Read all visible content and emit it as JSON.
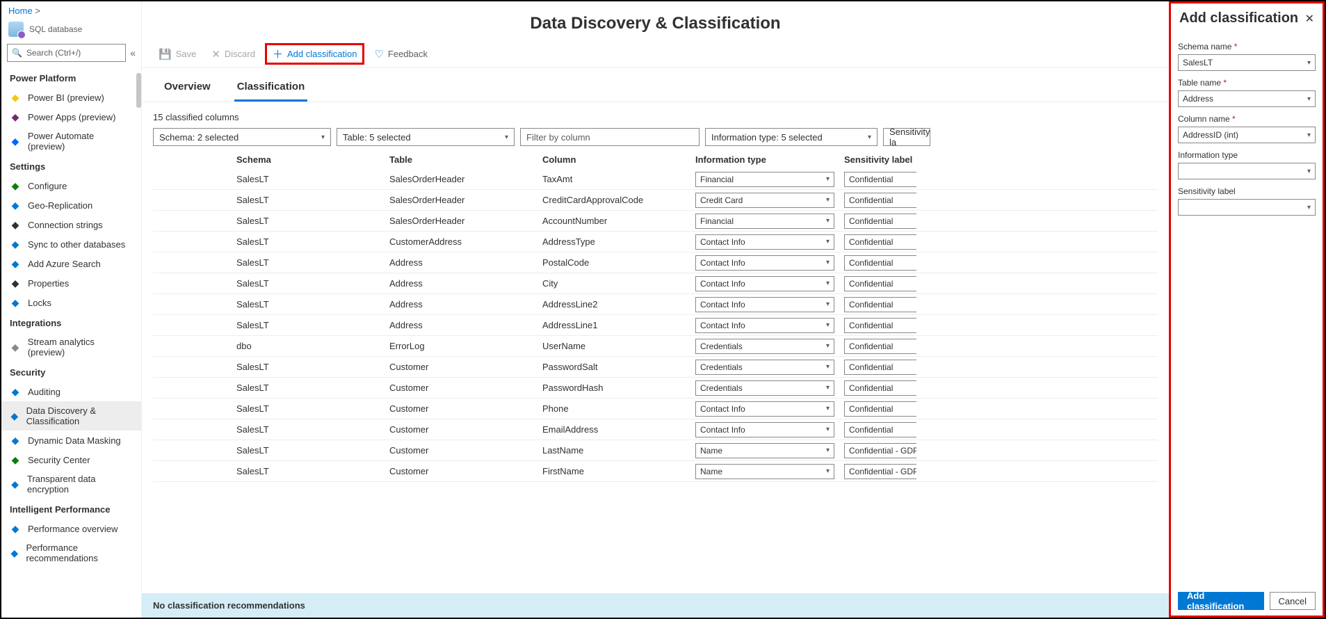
{
  "breadcrumb": {
    "home": "Home"
  },
  "resource": {
    "subtitle": "SQL database"
  },
  "search": {
    "placeholder": "Search (Ctrl+/)"
  },
  "sidebar": {
    "groups": [
      {
        "title": "Power Platform",
        "items": [
          {
            "label": "Power BI (preview)",
            "color": "#f2c811"
          },
          {
            "label": "Power Apps (preview)",
            "color": "#742774"
          },
          {
            "label": "Power Automate (preview)",
            "color": "#0066ff"
          }
        ]
      },
      {
        "title": "Settings",
        "items": [
          {
            "label": "Configure",
            "color": "#107c10"
          },
          {
            "label": "Geo-Replication",
            "color": "#0078d4"
          },
          {
            "label": "Connection strings",
            "color": "#323130"
          },
          {
            "label": "Sync to other databases",
            "color": "#0078d4"
          },
          {
            "label": "Add Azure Search",
            "color": "#0078d4"
          },
          {
            "label": "Properties",
            "color": "#323130"
          },
          {
            "label": "Locks",
            "color": "#0078d4"
          }
        ]
      },
      {
        "title": "Integrations",
        "items": [
          {
            "label": "Stream analytics (preview)",
            "color": "#8a8886"
          }
        ]
      },
      {
        "title": "Security",
        "items": [
          {
            "label": "Auditing",
            "color": "#0078d4"
          },
          {
            "label": "Data Discovery & Classification",
            "color": "#0078d4",
            "active": true
          },
          {
            "label": "Dynamic Data Masking",
            "color": "#0078d4"
          },
          {
            "label": "Security Center",
            "color": "#107c10"
          },
          {
            "label": "Transparent data encryption",
            "color": "#0078d4"
          }
        ]
      },
      {
        "title": "Intelligent Performance",
        "items": [
          {
            "label": "Performance overview",
            "color": "#0078d4"
          },
          {
            "label": "Performance recommendations",
            "color": "#0078d4"
          }
        ]
      }
    ]
  },
  "page": {
    "title": "Data Discovery & Classification"
  },
  "toolbar": {
    "save": "Save",
    "discard": "Discard",
    "add": "Add classification",
    "feedback": "Feedback"
  },
  "tabs": {
    "overview": "Overview",
    "classification": "Classification"
  },
  "counts": {
    "line": "15 classified columns"
  },
  "filters": {
    "schema": "Schema: 2 selected",
    "table": "Table: 5 selected",
    "column_ph": "Filter by column",
    "info": "Information type: 5 selected",
    "sens": "Sensitivity la"
  },
  "columns": {
    "schema": "Schema",
    "table": "Table",
    "column": "Column",
    "info": "Information type",
    "sens": "Sensitivity label"
  },
  "rows": [
    {
      "schema": "SalesLT",
      "table": "SalesOrderHeader",
      "column": "TaxAmt",
      "info": "Financial",
      "sens": "Confidential"
    },
    {
      "schema": "SalesLT",
      "table": "SalesOrderHeader",
      "column": "CreditCardApprovalCode",
      "info": "Credit Card",
      "sens": "Confidential"
    },
    {
      "schema": "SalesLT",
      "table": "SalesOrderHeader",
      "column": "AccountNumber",
      "info": "Financial",
      "sens": "Confidential"
    },
    {
      "schema": "SalesLT",
      "table": "CustomerAddress",
      "column": "AddressType",
      "info": "Contact Info",
      "sens": "Confidential"
    },
    {
      "schema": "SalesLT",
      "table": "Address",
      "column": "PostalCode",
      "info": "Contact Info",
      "sens": "Confidential"
    },
    {
      "schema": "SalesLT",
      "table": "Address",
      "column": "City",
      "info": "Contact Info",
      "sens": "Confidential"
    },
    {
      "schema": "SalesLT",
      "table": "Address",
      "column": "AddressLine2",
      "info": "Contact Info",
      "sens": "Confidential"
    },
    {
      "schema": "SalesLT",
      "table": "Address",
      "column": "AddressLine1",
      "info": "Contact Info",
      "sens": "Confidential"
    },
    {
      "schema": "dbo",
      "table": "ErrorLog",
      "column": "UserName",
      "info": "Credentials",
      "sens": "Confidential"
    },
    {
      "schema": "SalesLT",
      "table": "Customer",
      "column": "PasswordSalt",
      "info": "Credentials",
      "sens": "Confidential"
    },
    {
      "schema": "SalesLT",
      "table": "Customer",
      "column": "PasswordHash",
      "info": "Credentials",
      "sens": "Confidential"
    },
    {
      "schema": "SalesLT",
      "table": "Customer",
      "column": "Phone",
      "info": "Contact Info",
      "sens": "Confidential"
    },
    {
      "schema": "SalesLT",
      "table": "Customer",
      "column": "EmailAddress",
      "info": "Contact Info",
      "sens": "Confidential"
    },
    {
      "schema": "SalesLT",
      "table": "Customer",
      "column": "LastName",
      "info": "Name",
      "sens": "Confidential - GDPR"
    },
    {
      "schema": "SalesLT",
      "table": "Customer",
      "column": "FirstName",
      "info": "Name",
      "sens": "Confidential - GDPR"
    }
  ],
  "recommendation": "No classification recommendations",
  "panel": {
    "title": "Add classification",
    "schema_lbl": "Schema name",
    "schema_val": "SalesLT",
    "table_lbl": "Table name",
    "table_val": "Address",
    "column_lbl": "Column name",
    "column_val": "AddressID (int)",
    "info_lbl": "Information type",
    "info_val": "",
    "sens_lbl": "Sensitivity label",
    "sens_val": "",
    "add_btn": "Add classification",
    "cancel_btn": "Cancel"
  }
}
